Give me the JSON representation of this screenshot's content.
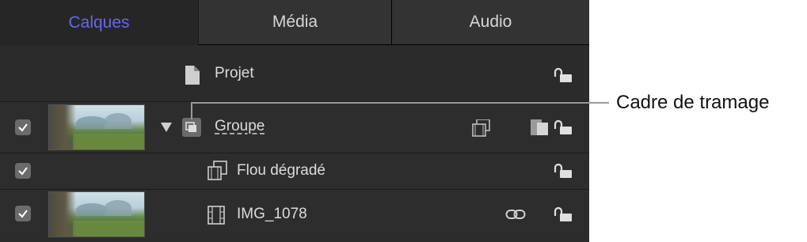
{
  "tabs": [
    {
      "label": "Calques",
      "active": true
    },
    {
      "label": "Média",
      "active": false
    },
    {
      "label": "Audio",
      "active": false
    }
  ],
  "layers": {
    "projet": {
      "name": "Projet",
      "icon": "document-icon"
    },
    "groupe": {
      "name": "Groupe",
      "icon": "group-icon",
      "checked": true
    },
    "flou": {
      "name": "Flou dégradé",
      "icon": "filter-icon",
      "checked": true
    },
    "img": {
      "name": "IMG_1078",
      "icon": "film-icon",
      "checked": true
    }
  },
  "callout": {
    "text": "Cadre de tramage"
  },
  "colors": {
    "accent": "#6767ee",
    "panel": "#2b2b2b",
    "text": "#dcdcdc"
  }
}
